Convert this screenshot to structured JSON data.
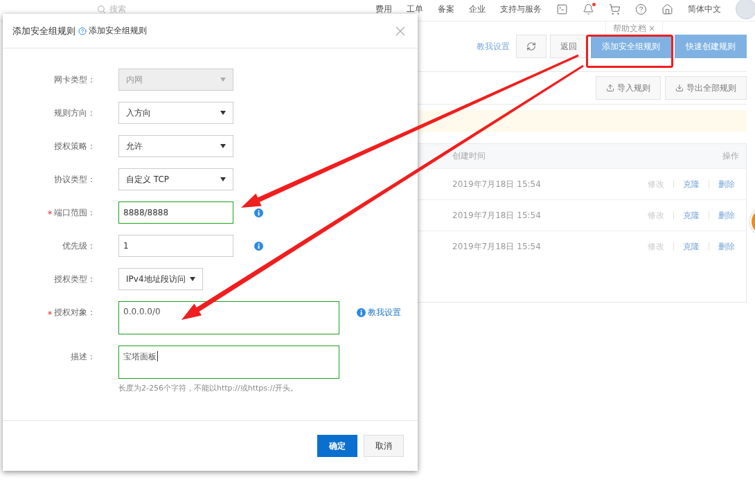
{
  "nav": {
    "search_placeholder": "搜索",
    "links": [
      "费用",
      "工单",
      "备案",
      "企业",
      "支持与服务"
    ],
    "bell_unread": true,
    "language": "简体中文"
  },
  "help_tooltip": {
    "label": "帮助文档",
    "close": "×"
  },
  "toolbar": {
    "teach_link": "教我设置",
    "back": "返回",
    "add": "添加安全组规则",
    "quick_create": "快速创建规则",
    "import": "导入规则",
    "export": "导出全部规则"
  },
  "table": {
    "columns": [
      "创建时间",
      "操作"
    ],
    "rows": [
      {
        "created": "2019年7月18日 15:54",
        "actions": [
          {
            "label": "修改",
            "disabled": true
          },
          {
            "label": "克隆",
            "disabled": false
          },
          {
            "label": "删除",
            "disabled": false
          }
        ]
      },
      {
        "created": "2019年7月18日 15:54",
        "actions": [
          {
            "label": "修改",
            "disabled": true
          },
          {
            "label": "克隆",
            "disabled": false
          },
          {
            "label": "删除",
            "disabled": false
          }
        ]
      },
      {
        "created": "2019年7月18日 15:54",
        "actions": [
          {
            "label": "修改",
            "disabled": true
          },
          {
            "label": "克隆",
            "disabled": false
          },
          {
            "label": "删除",
            "disabled": false
          }
        ]
      }
    ]
  },
  "dialog": {
    "title": "添加安全组规则",
    "help_link": "添加安全组规则",
    "fields": [
      {
        "kind": "select",
        "label": "网卡类型：",
        "value": "内网",
        "disabled": true,
        "required": false,
        "valid": false,
        "info": false
      },
      {
        "kind": "select",
        "label": "规则方向：",
        "value": "入方向",
        "disabled": false,
        "required": false,
        "valid": false,
        "info": false
      },
      {
        "kind": "select",
        "label": "授权策略：",
        "value": "允许",
        "disabled": false,
        "required": false,
        "valid": false,
        "info": false
      },
      {
        "kind": "select",
        "label": "协议类型：",
        "value": "自定义 TCP",
        "disabled": false,
        "required": false,
        "valid": false,
        "info": false
      },
      {
        "kind": "input",
        "label": "端口范围：",
        "value": "8888/8888",
        "disabled": false,
        "required": true,
        "valid": true,
        "info": true
      },
      {
        "kind": "input",
        "label": "优先级：",
        "value": "1",
        "disabled": false,
        "required": false,
        "valid": false,
        "info": true
      },
      {
        "kind": "compact-select",
        "label": "授权类型：",
        "value": "IPv4地址段访问",
        "disabled": false,
        "required": false,
        "valid": false,
        "info": false
      },
      {
        "kind": "textarea",
        "label": "授权对象：",
        "value": "0.0.0.0/0",
        "disabled": false,
        "required": true,
        "valid": true,
        "info": false,
        "link": "教我设置"
      },
      {
        "kind": "textarea",
        "label": "描述：",
        "value": "宝塔面板",
        "disabled": false,
        "required": false,
        "valid": true,
        "info": false,
        "focused": true,
        "hint": "长度为2-256个字符，不能以http://或https://开头。"
      }
    ],
    "buttons": {
      "confirm": "确定",
      "cancel": "取消"
    }
  }
}
